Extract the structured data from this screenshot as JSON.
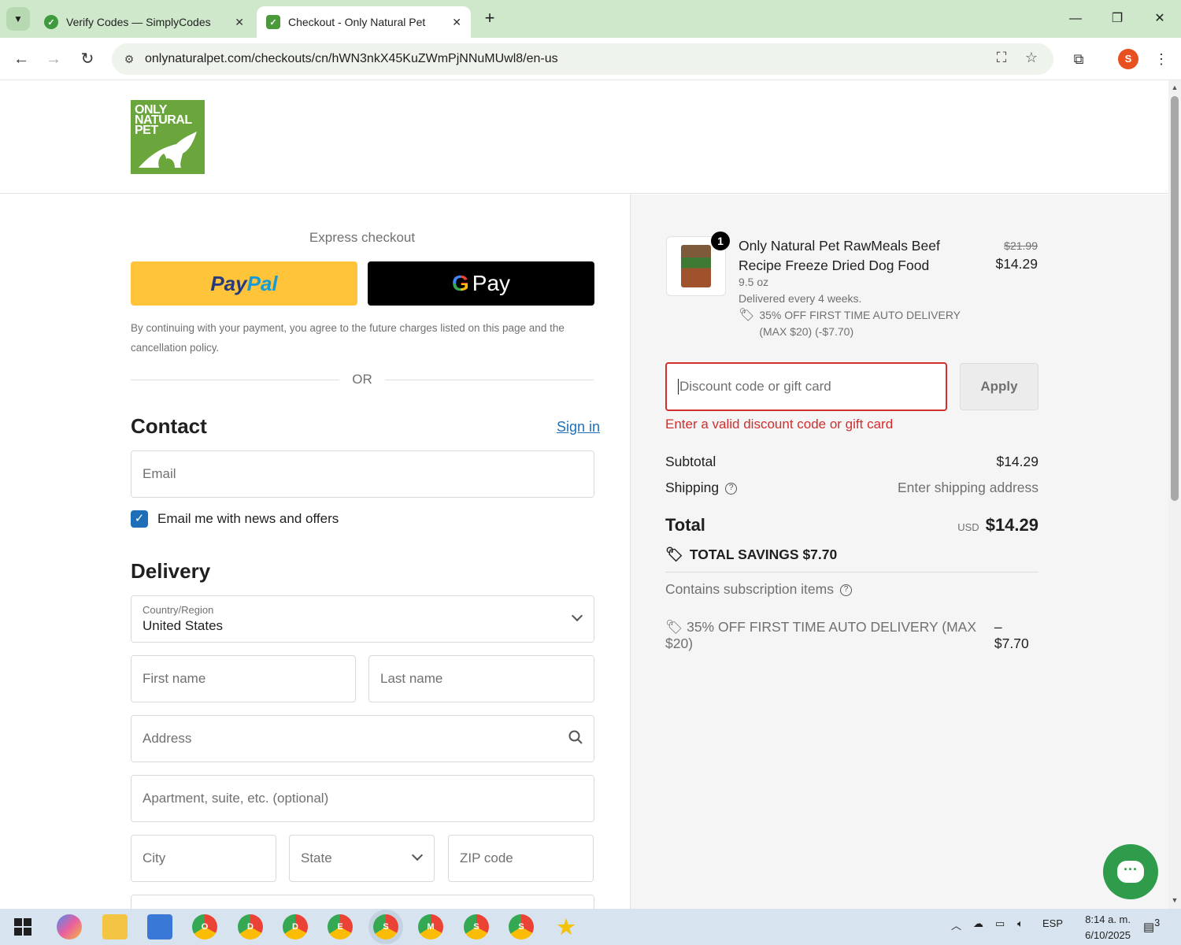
{
  "browser": {
    "tabs": [
      {
        "title": "Verify Codes — SimplyCodes",
        "active": false
      },
      {
        "title": "Checkout - Only Natural Pet",
        "active": true
      }
    ],
    "url": "onlynaturalpet.com/checkouts/cn/hWN3nkX45KuZWmPjNNuMUwl8/en-us",
    "profile_initial": "S"
  },
  "logo": {
    "line1": "ONLY",
    "line2": "NATURAL",
    "line3": "PET"
  },
  "express": {
    "label": "Express checkout",
    "paypal_a": "Pay",
    "paypal_b": "Pal",
    "gpay_g": "G",
    "gpay_label": "Pay",
    "consent": "By continuing with your payment, you agree to the future charges listed on this page and the cancellation policy.",
    "or": "OR"
  },
  "contact": {
    "title": "Contact",
    "sign_in": "Sign in",
    "email_placeholder": "Email",
    "newsletter_label": "Email me with news and offers",
    "newsletter_checked": true
  },
  "delivery": {
    "title": "Delivery",
    "country_label": "Country/Region",
    "country_value": "United States",
    "first_name": "First name",
    "last_name": "Last name",
    "address": "Address",
    "apartment": "Apartment, suite, etc. (optional)",
    "city": "City",
    "state": "State",
    "zip": "ZIP code"
  },
  "summary": {
    "product": {
      "quantity": "1",
      "name": "Only Natural Pet RawMeals Beef Recipe Freeze Dried Dog Food",
      "size": "9.5 oz",
      "frequency": "Delivered every 4 weeks.",
      "discount": "35% OFF FIRST TIME AUTO DELIVERY (MAX $20) (-$7.70)",
      "price_original": "$21.99",
      "price": "$14.29"
    },
    "discount_placeholder": "Discount code or gift card",
    "apply_label": "Apply",
    "error": "Enter a valid discount code or gift card",
    "subtotal_label": "Subtotal",
    "subtotal_value": "$14.29",
    "shipping_label": "Shipping",
    "shipping_value": "Enter shipping address",
    "total_label": "Total",
    "total_currency": "USD",
    "total_value": "$14.29",
    "savings_label": "TOTAL SAVINGS",
    "savings_value": "$7.70",
    "subscription_note": "Contains subscription items",
    "promo_label": "35% OFF FIRST TIME AUTO DELIVERY (MAX $20)",
    "promo_value": "– $7.70"
  },
  "taskbar": {
    "language": "ESP",
    "time": "8:14 a. m.",
    "date": "6/10/2025",
    "notifications": "3",
    "app_badges": [
      "O",
      "D",
      "D",
      "E",
      "S",
      "M",
      "S",
      "S"
    ]
  },
  "colors": {
    "accent_blue": "#1e6fb8",
    "error_red": "#d12e2e",
    "paypal_yellow": "#ffc439",
    "brand_green": "#6aa63c"
  }
}
